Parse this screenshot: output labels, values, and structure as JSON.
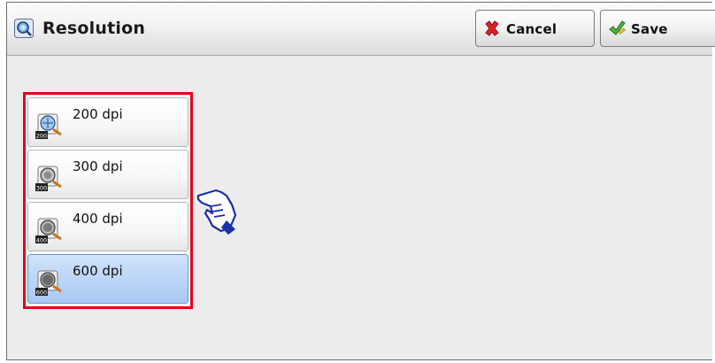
{
  "header": {
    "title": "Resolution",
    "title_icon": "magnifier-resolution-icon",
    "cancel_label": "Cancel",
    "save_label": "Save",
    "cancel_icon": "red-x-icon",
    "save_icon": "green-check-pencil-icon"
  },
  "resolution_options": {
    "items": [
      {
        "label": "200 dpi",
        "badge": "200",
        "selected": false
      },
      {
        "label": "300 dpi",
        "badge": "300",
        "selected": false
      },
      {
        "label": "400 dpi",
        "badge": "400",
        "selected": false
      },
      {
        "label": "600 dpi",
        "badge": "600",
        "selected": true
      }
    ]
  },
  "annotation": {
    "pointer_icon": "pointing-hand-icon",
    "highlight_color": "#e3001b"
  },
  "colors": {
    "selected_item": "#a9c9f2",
    "panel_background": "#ececec"
  }
}
